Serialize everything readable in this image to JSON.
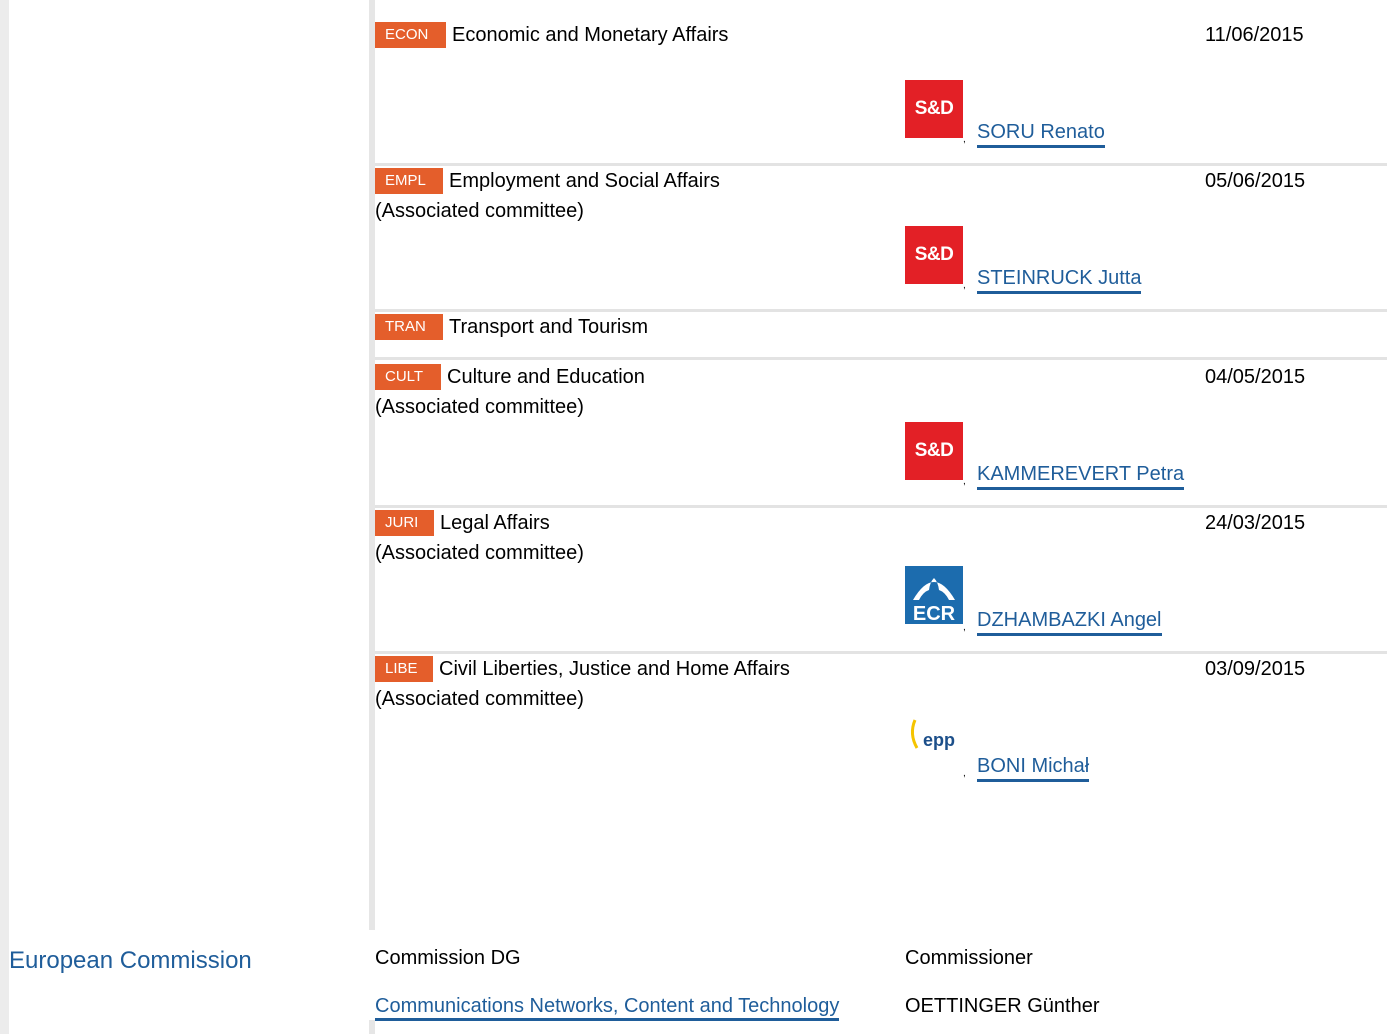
{
  "committees": [
    {
      "abbr": "ECON",
      "name": "Economic and Monetary Affairs",
      "associated": "",
      "date": "11/06/2015",
      "group_icon": "S&D",
      "rapporteur": "SORU Renato"
    },
    {
      "abbr": "EMPL",
      "name": "Employment and Social Affairs",
      "associated": "(Associated committee)",
      "date": "05/06/2015",
      "group_icon": "S&D",
      "rapporteur": "STEINRUCK Jutta"
    },
    {
      "abbr": "TRAN",
      "name": "Transport and Tourism",
      "associated": "",
      "date": "",
      "group_icon": "",
      "rapporteur": ""
    },
    {
      "abbr": "CULT",
      "name": "Culture and Education",
      "associated": "(Associated committee)",
      "date": "04/05/2015",
      "group_icon": "S&D",
      "rapporteur": "KAMMEREVERT Petra"
    },
    {
      "abbr": "JURI",
      "name": "Legal Affairs",
      "associated": "(Associated committee)",
      "date": "24/03/2015",
      "group_icon": "ECR",
      "rapporteur": "DZHAMBAZKI Angel"
    },
    {
      "abbr": "LIBE",
      "name": "Civil Liberties, Justice and Home Affairs",
      "associated": "(Associated committee)",
      "date": "03/09/2015",
      "group_icon": "epp",
      "rapporteur": "BONI Michał"
    }
  ],
  "commission": {
    "title": "European Commission",
    "dg_header": "Commission DG",
    "commissioner_header": "Commissioner",
    "dg_link": "Communications Networks, Content and Technology",
    "commissioner": "OETTINGER Günther"
  },
  "colors": {
    "badge": "#e45e2b",
    "link": "#1f5d9a",
    "sd": "#e32026",
    "ecr": "#1c6cae"
  },
  "icons": {
    "comma": ","
  }
}
